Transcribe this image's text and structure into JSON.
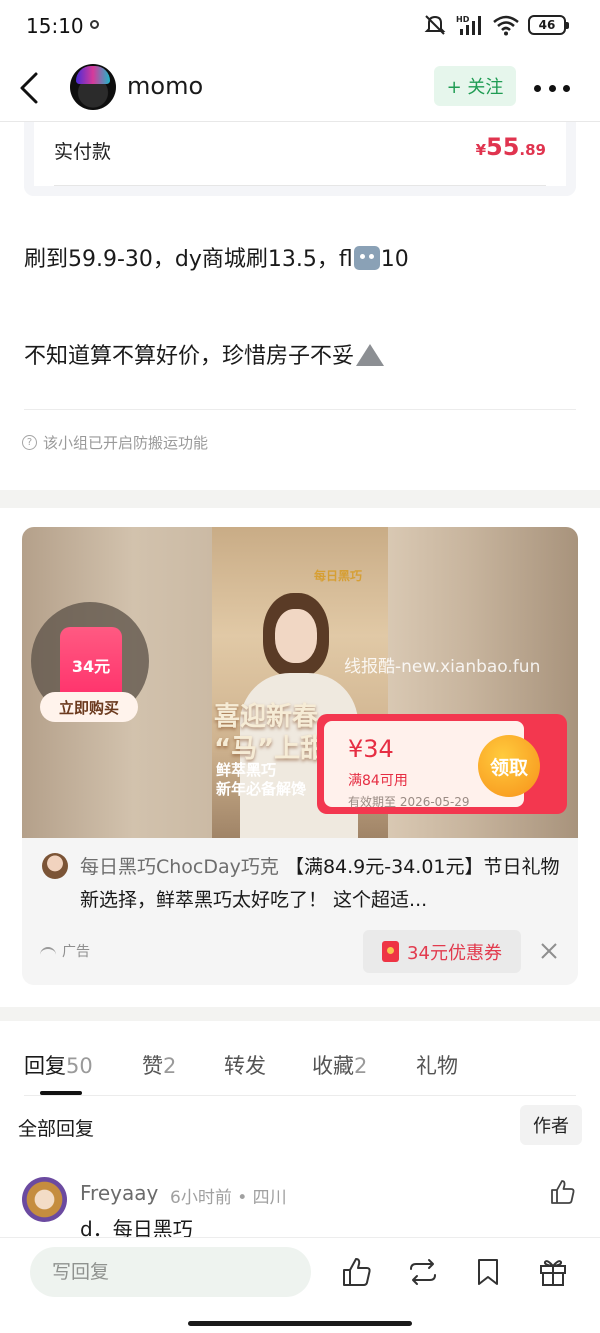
{
  "status_bar": {
    "time": "15:10",
    "battery": "46"
  },
  "header": {
    "username": "momo",
    "follow_label": "+ 关注"
  },
  "order": {
    "paid_label": "实付款",
    "currency": "¥",
    "amount_int": "55",
    "amount_dec": ".89"
  },
  "post": {
    "line1_before": "刷到59.9-30，dy商城刷13.5，fl",
    "line1_after": "10",
    "line2": "不知道算不算好价，珍惜房子不妥",
    "notice": "该小组已开启防搬运功能"
  },
  "ad": {
    "brand": "每日黑巧",
    "headline_1": "喜迎新春",
    "headline_2": "“马”上甜蜜",
    "sub_1": "鲜萃黑巧",
    "sub_2": "新年必备解馋",
    "price_ticket": "34元",
    "buy_label": "立即购买",
    "watermark": "线报酷-new.xianbao.fun",
    "coupon_value": "¥34",
    "coupon_condition": "满84可用",
    "coupon_expiry": "有效期至 2026-05-29",
    "claim_label": "领取",
    "author": "每日黑巧ChocDay巧克",
    "title_text": "【满84.9元-34.01元】节日礼物新选择，鲜萃黑巧太好吃了！ 这个超适...",
    "ad_tag": "广告",
    "coupon_chip": "34元优惠券"
  },
  "tabs": [
    {
      "label": "回复",
      "count": "50"
    },
    {
      "label": "赞",
      "count": "2"
    },
    {
      "label": "转发",
      "count": ""
    },
    {
      "label": "收藏",
      "count": "2"
    },
    {
      "label": "礼物",
      "count": ""
    }
  ],
  "replies": {
    "filter_label": "全部回复",
    "author_filter": "作者",
    "first": {
      "user": "Freyaay",
      "meta": "6小时前 • 四川",
      "text": "d．每日黑巧"
    }
  },
  "bottom_bar": {
    "reply_placeholder": "写回复"
  },
  "colors": {
    "accent_green": "#1f9c53",
    "price_red": "#e0344f",
    "coupon_red": "#f3374f"
  }
}
